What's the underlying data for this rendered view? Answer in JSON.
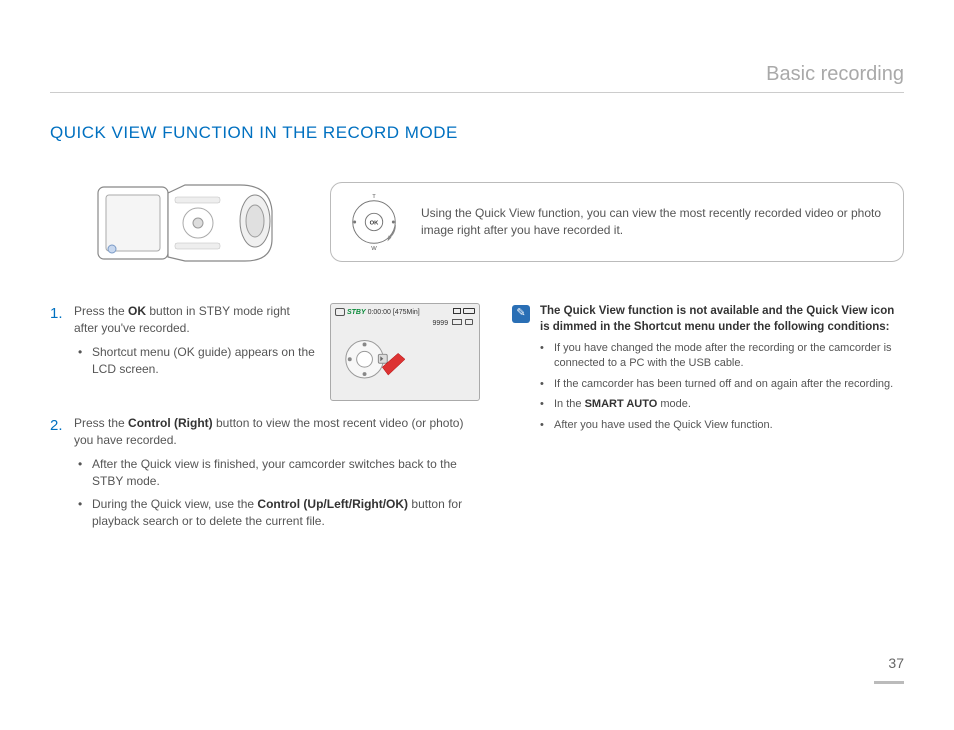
{
  "chapter_title": "Basic recording",
  "section_title": "QUICK VIEW FUNCTION IN THE RECORD MODE",
  "callout": {
    "ok_label": "OK",
    "dial_top": "T",
    "dial_bottom": "W",
    "text": "Using the Quick View function, you can view the most recently recorded video or photo image right after you have recorded it."
  },
  "steps": [
    {
      "num": "1.",
      "bold": "OK",
      "body_before": "Press the ",
      "body_after": " button in STBY mode right after you've recorded.",
      "bullets": [
        "Shortcut menu (OK guide) appears on the LCD screen."
      ]
    },
    {
      "num": "2.",
      "bold": "Control (Right)",
      "body_before": "Press the ",
      "body_after": " button to view the most recent video (or photo) you have recorded.",
      "bullets": [
        "After the Quick view is finished, your camcorder switches back to the STBY mode.",
        {
          "pre": "During the Quick view, use the ",
          "bold": "Control (Up/Left/Right/OK)",
          "post": " button for playback search or to delete the current file."
        }
      ]
    }
  ],
  "lcd": {
    "stby": "STBY",
    "time": "0:00:00",
    "remain": "[475Min]",
    "photo_count": "9999"
  },
  "note": {
    "icon": "✎",
    "header": "The Quick View function is not available and the Quick View icon is dimmed in the Shortcut menu under the following conditions:",
    "bullets": [
      "If you have changed the mode after the recording or the camcorder is connected to a PC with the USB cable.",
      "If the camcorder has been turned off and on again after the recording.",
      {
        "pre": "In the ",
        "bold": "SMART AUTO",
        "post": " mode."
      },
      "After you have used the Quick View function."
    ]
  },
  "page_number": "37"
}
